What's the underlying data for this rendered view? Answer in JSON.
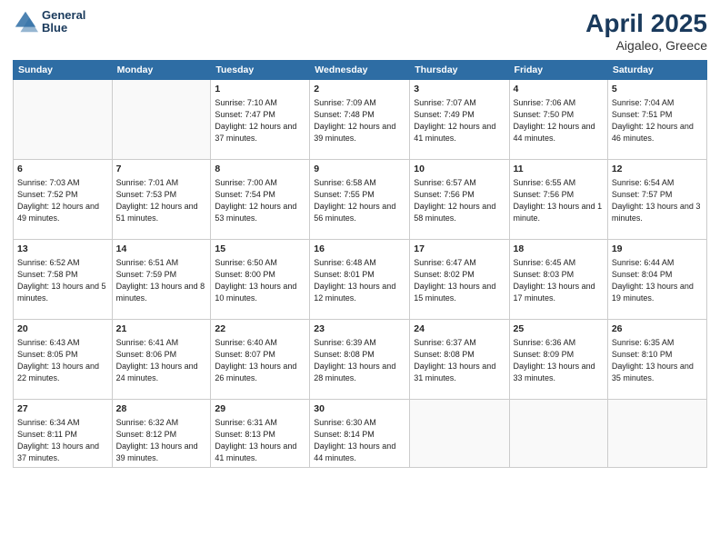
{
  "header": {
    "logo_line1": "General",
    "logo_line2": "Blue",
    "title": "April 2025",
    "subtitle": "Aigaleo, Greece"
  },
  "columns": [
    "Sunday",
    "Monday",
    "Tuesday",
    "Wednesday",
    "Thursday",
    "Friday",
    "Saturday"
  ],
  "weeks": [
    [
      {
        "day": "",
        "info": ""
      },
      {
        "day": "",
        "info": ""
      },
      {
        "day": "1",
        "info": "Sunrise: 7:10 AM\nSunset: 7:47 PM\nDaylight: 12 hours\nand 37 minutes."
      },
      {
        "day": "2",
        "info": "Sunrise: 7:09 AM\nSunset: 7:48 PM\nDaylight: 12 hours\nand 39 minutes."
      },
      {
        "day": "3",
        "info": "Sunrise: 7:07 AM\nSunset: 7:49 PM\nDaylight: 12 hours\nand 41 minutes."
      },
      {
        "day": "4",
        "info": "Sunrise: 7:06 AM\nSunset: 7:50 PM\nDaylight: 12 hours\nand 44 minutes."
      },
      {
        "day": "5",
        "info": "Sunrise: 7:04 AM\nSunset: 7:51 PM\nDaylight: 12 hours\nand 46 minutes."
      }
    ],
    [
      {
        "day": "6",
        "info": "Sunrise: 7:03 AM\nSunset: 7:52 PM\nDaylight: 12 hours\nand 49 minutes."
      },
      {
        "day": "7",
        "info": "Sunrise: 7:01 AM\nSunset: 7:53 PM\nDaylight: 12 hours\nand 51 minutes."
      },
      {
        "day": "8",
        "info": "Sunrise: 7:00 AM\nSunset: 7:54 PM\nDaylight: 12 hours\nand 53 minutes."
      },
      {
        "day": "9",
        "info": "Sunrise: 6:58 AM\nSunset: 7:55 PM\nDaylight: 12 hours\nand 56 minutes."
      },
      {
        "day": "10",
        "info": "Sunrise: 6:57 AM\nSunset: 7:56 PM\nDaylight: 12 hours\nand 58 minutes."
      },
      {
        "day": "11",
        "info": "Sunrise: 6:55 AM\nSunset: 7:56 PM\nDaylight: 13 hours\nand 1 minute."
      },
      {
        "day": "12",
        "info": "Sunrise: 6:54 AM\nSunset: 7:57 PM\nDaylight: 13 hours\nand 3 minutes."
      }
    ],
    [
      {
        "day": "13",
        "info": "Sunrise: 6:52 AM\nSunset: 7:58 PM\nDaylight: 13 hours\nand 5 minutes."
      },
      {
        "day": "14",
        "info": "Sunrise: 6:51 AM\nSunset: 7:59 PM\nDaylight: 13 hours\nand 8 minutes."
      },
      {
        "day": "15",
        "info": "Sunrise: 6:50 AM\nSunset: 8:00 PM\nDaylight: 13 hours\nand 10 minutes."
      },
      {
        "day": "16",
        "info": "Sunrise: 6:48 AM\nSunset: 8:01 PM\nDaylight: 13 hours\nand 12 minutes."
      },
      {
        "day": "17",
        "info": "Sunrise: 6:47 AM\nSunset: 8:02 PM\nDaylight: 13 hours\nand 15 minutes."
      },
      {
        "day": "18",
        "info": "Sunrise: 6:45 AM\nSunset: 8:03 PM\nDaylight: 13 hours\nand 17 minutes."
      },
      {
        "day": "19",
        "info": "Sunrise: 6:44 AM\nSunset: 8:04 PM\nDaylight: 13 hours\nand 19 minutes."
      }
    ],
    [
      {
        "day": "20",
        "info": "Sunrise: 6:43 AM\nSunset: 8:05 PM\nDaylight: 13 hours\nand 22 minutes."
      },
      {
        "day": "21",
        "info": "Sunrise: 6:41 AM\nSunset: 8:06 PM\nDaylight: 13 hours\nand 24 minutes."
      },
      {
        "day": "22",
        "info": "Sunrise: 6:40 AM\nSunset: 8:07 PM\nDaylight: 13 hours\nand 26 minutes."
      },
      {
        "day": "23",
        "info": "Sunrise: 6:39 AM\nSunset: 8:08 PM\nDaylight: 13 hours\nand 28 minutes."
      },
      {
        "day": "24",
        "info": "Sunrise: 6:37 AM\nSunset: 8:08 PM\nDaylight: 13 hours\nand 31 minutes."
      },
      {
        "day": "25",
        "info": "Sunrise: 6:36 AM\nSunset: 8:09 PM\nDaylight: 13 hours\nand 33 minutes."
      },
      {
        "day": "26",
        "info": "Sunrise: 6:35 AM\nSunset: 8:10 PM\nDaylight: 13 hours\nand 35 minutes."
      }
    ],
    [
      {
        "day": "27",
        "info": "Sunrise: 6:34 AM\nSunset: 8:11 PM\nDaylight: 13 hours\nand 37 minutes."
      },
      {
        "day": "28",
        "info": "Sunrise: 6:32 AM\nSunset: 8:12 PM\nDaylight: 13 hours\nand 39 minutes."
      },
      {
        "day": "29",
        "info": "Sunrise: 6:31 AM\nSunset: 8:13 PM\nDaylight: 13 hours\nand 41 minutes."
      },
      {
        "day": "30",
        "info": "Sunrise: 6:30 AM\nSunset: 8:14 PM\nDaylight: 13 hours\nand 44 minutes."
      },
      {
        "day": "",
        "info": ""
      },
      {
        "day": "",
        "info": ""
      },
      {
        "day": "",
        "info": ""
      }
    ]
  ]
}
